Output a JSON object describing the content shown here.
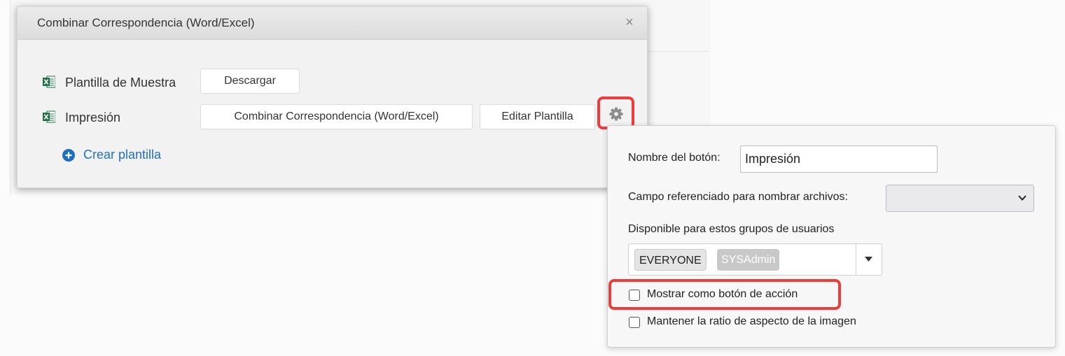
{
  "dialog": {
    "title": "Combinar Correspondencia (Word/Excel)",
    "close_icon": "close-icon",
    "rows": [
      {
        "icon": "excel-icon",
        "label": "Plantilla de Muestra",
        "buttons": [
          "Descargar"
        ]
      },
      {
        "icon": "excel-icon",
        "label": "Impresión",
        "buttons": [
          "Combinar Correspondencia (Word/Excel)",
          "Editar Plantilla"
        ],
        "settings_icon": "gear-icon"
      }
    ],
    "create_link": {
      "icon": "plus-circle-icon",
      "label": "Crear plantilla"
    }
  },
  "settings": {
    "button_name_label": "Nombre del botón:",
    "button_name_value": "Impresión",
    "filename_field_label": "Campo referenciado para nombrar archivos:",
    "filename_field_value": "",
    "groups_label": "Disponible para estos grupos de usuarios",
    "groups": [
      "EVERYONE",
      "SYSAdmin"
    ],
    "checkbox_action_label": "Mostrar como botón de acción",
    "checkbox_action_checked": false,
    "checkbox_ratio_label": "Mantener la ratio de aspecto de la imagen",
    "checkbox_ratio_checked": false
  },
  "colors": {
    "highlight": "#ee3b3b",
    "link": "#1f6fc0",
    "excel_green": "#1d7044"
  }
}
